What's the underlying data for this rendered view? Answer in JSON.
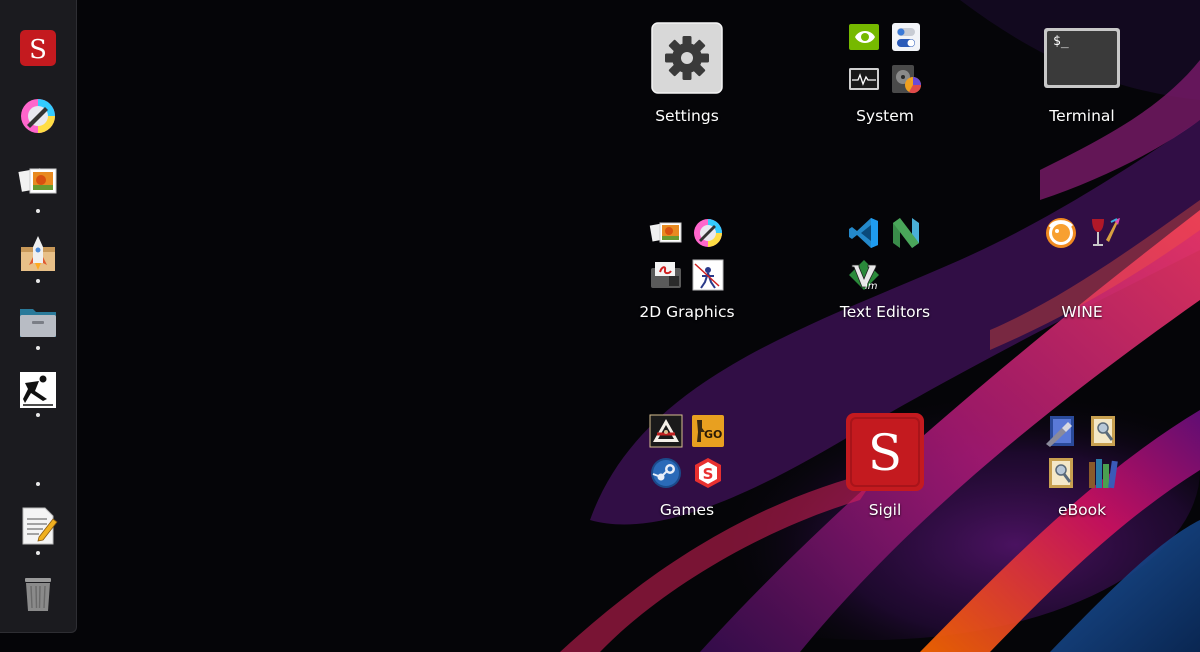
{
  "dock": {
    "items": [
      {
        "name": "sigil",
        "label": "Sigil",
        "running": false
      },
      {
        "name": "krita",
        "label": "Krita",
        "running": false
      },
      {
        "name": "image-viewer",
        "label": "Image Viewer",
        "running": true
      },
      {
        "name": "app-installer",
        "label": "App Installer",
        "running": true
      },
      {
        "name": "files",
        "label": "Files",
        "running": true
      },
      {
        "name": "zbrush",
        "label": "ZBrush",
        "running": true
      },
      {
        "name": "text-editor",
        "label": "Text Editor",
        "running": true
      },
      {
        "name": "trash",
        "label": "Trash",
        "running": false
      }
    ]
  },
  "grid": {
    "items": [
      {
        "name": "settings",
        "label": "Settings",
        "type": "app",
        "icon": "gear-icon"
      },
      {
        "name": "system",
        "label": "System",
        "type": "folder",
        "icons": [
          "nvidia-icon",
          "toggle-settings-icon",
          "system-monitor-icon",
          "disk-usage-icon"
        ]
      },
      {
        "name": "terminal",
        "label": "Terminal",
        "type": "app",
        "icon": "terminal-icon",
        "prompt": "$_"
      },
      {
        "name": "2d-graphics",
        "label": "2D Graphics",
        "type": "folder",
        "icons": [
          "image-viewer-icon",
          "krita-icon",
          "pdf-editor-icon",
          "drawing-icon"
        ]
      },
      {
        "name": "text-editors",
        "label": "Text Editors",
        "type": "folder",
        "icons": [
          "vscode-icon",
          "neovim-icon",
          "vim-icon"
        ],
        "vim_text": "im"
      },
      {
        "name": "wine",
        "label": "WINE",
        "type": "folder",
        "icons": [
          "bottles-icon",
          "wine-glass-icon"
        ]
      },
      {
        "name": "games",
        "label": "Games",
        "type": "folder",
        "icons": [
          "action-game-icon",
          "csgo-icon",
          "steam-icon",
          "substance-icon"
        ],
        "csgo_text": "GO"
      },
      {
        "name": "sigil",
        "label": "Sigil",
        "type": "app",
        "icon": "sigil-icon"
      },
      {
        "name": "ebook",
        "label": "eBook",
        "type": "folder",
        "icons": [
          "calibre-edit-icon",
          "calibre-viewer-icon",
          "calibre-lib-icon",
          "calibre-books-icon"
        ]
      }
    ]
  },
  "colors": {
    "dock_bg": "#1b1b1f",
    "sigil_red": "#c41a1f",
    "vscode_blue": "#2489ca",
    "neovim_green": "#3a8c4a",
    "wallpaper_magenta": "#8a1a7a"
  }
}
